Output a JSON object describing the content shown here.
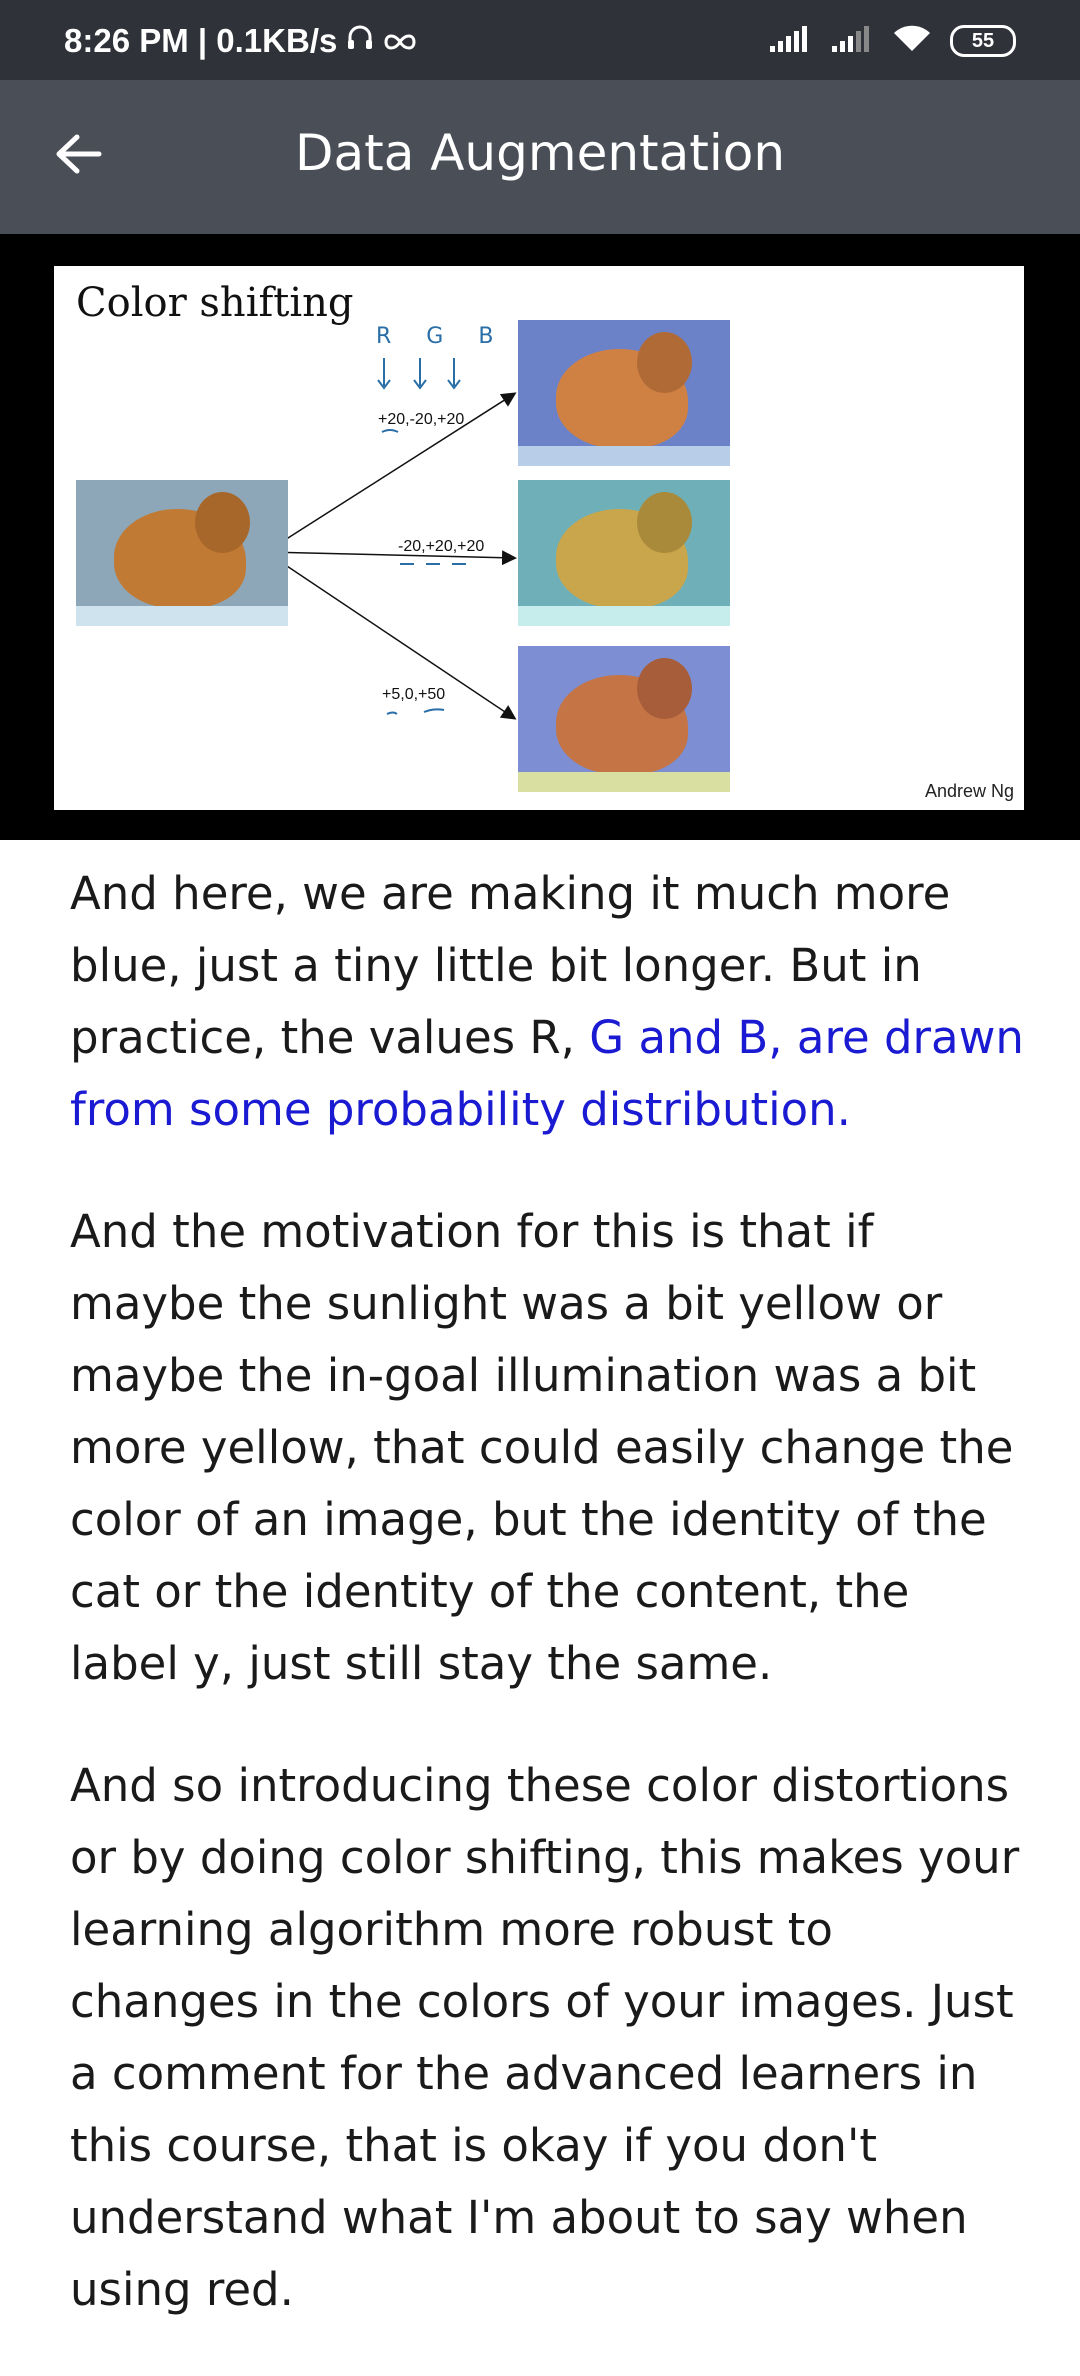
{
  "status_bar": {
    "time_net": "8:26 PM | 0.1KB/s",
    "battery": "55"
  },
  "app_bar": {
    "title": "Data Augmentation"
  },
  "slide": {
    "title": "Color shifting",
    "rgb_note": "R G B",
    "shift_top": "+20,-20,+20",
    "shift_middle": "-20,+20,+20",
    "shift_bottom": "+5,0,+50",
    "credit": "Andrew Ng"
  },
  "transcript": {
    "p1_plain": "And here, we are making it much more blue, just a tiny little bit longer. But in practice, the values R, ",
    "p1_highlight": "G and B, are drawn from some probability distribution.",
    "p2": "And the motivation for this is that if maybe the sunlight was a bit yellow or maybe the in-goal illumination was a bit more yellow, that could easily change the color of an image, but the identity of the cat or the identity of the content, the label y, just still stay the same.",
    "p3": "And so introducing these color distortions or by doing color shifting, this makes your learning algorithm more robust to changes in the colors of your images. Just a comment for the advanced learners in this course, that is okay if you don't understand what I'm about to say when using red."
  }
}
